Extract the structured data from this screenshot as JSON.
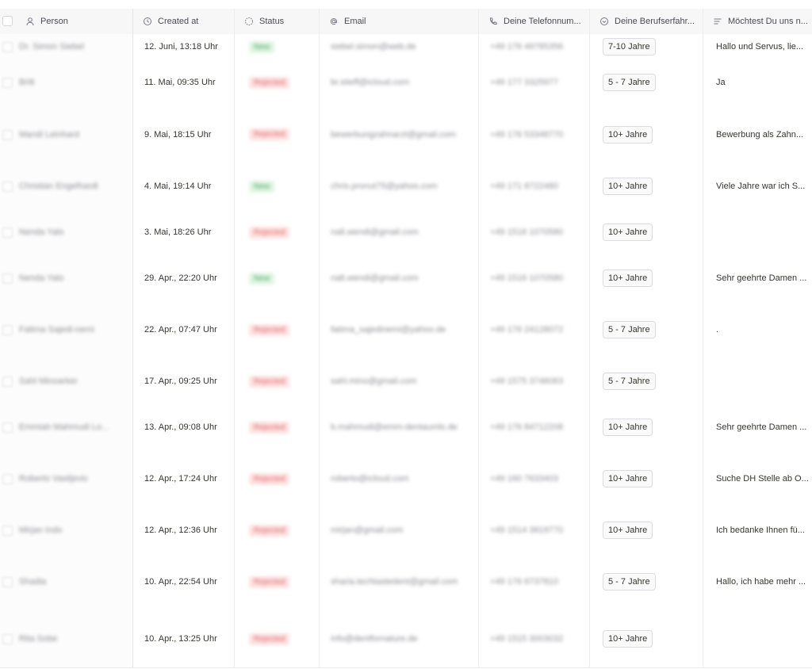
{
  "columns": [
    {
      "label": "Person",
      "icon": "person-icon"
    },
    {
      "label": "Created at",
      "icon": "clock-icon"
    },
    {
      "label": "Status",
      "icon": "status-icon"
    },
    {
      "label": "Email",
      "icon": "at-icon"
    },
    {
      "label": "Deine Telefonnum...",
      "icon": "phone-icon"
    },
    {
      "label": "Deine Berufserfahr...",
      "icon": "circle-select-icon"
    },
    {
      "label": "Möchtest Du uns n...",
      "icon": "text-lines-icon"
    }
  ],
  "rows": [
    {
      "person": "Dr. Simon Siebel",
      "created": "12. Juni, 13:18 Uhr",
      "status": "New",
      "email": "siebel.simon@web.de",
      "phone": "+49 176 49785356",
      "experience": "7-10 Jahre",
      "message": "Hallo und Servus, lie..."
    },
    {
      "person": "Britt",
      "created": "11. Mai, 09:35 Uhr",
      "status": "Rejected",
      "email": "br.stieff@icloud.com",
      "phone": "+49 177 3325977",
      "experience": "5 - 7 Jahre",
      "message": "Ja"
    },
    {
      "person": "Mandi Leinhard",
      "created": "9. Mai, 18:15 Uhr",
      "status": "Rejected",
      "email": "bewerbungzahnarzt@gmail.com",
      "phone": "+49 176 53348770",
      "experience": "10+ Jahre",
      "message": "Bewerbung als Zahn..."
    },
    {
      "person": "Christian Engelhardt",
      "created": "4. Mai, 19:14 Uhr",
      "status": "New",
      "email": "chris.pronut75@yahoo.com",
      "phone": "+49 171 8722480",
      "experience": "10+ Jahre",
      "message": "Viele Jahre war ich S..."
    },
    {
      "person": "Nenda Yalo",
      "created": "3. Mai, 18:26 Uhr",
      "status": "Rejected",
      "email": "nalt.wendi@gmail.com",
      "phone": "+49 1516 1070580",
      "experience": "10+ Jahre",
      "message": ""
    },
    {
      "person": "Nenda Yalo",
      "created": "29. Apr., 22:20 Uhr",
      "status": "New",
      "email": "nalt.wendi@gmail.com",
      "phone": "+49 1516 1070580",
      "experience": "10+ Jahre",
      "message": "Sehr geehrte Damen ..."
    },
    {
      "person": "Fatima Sajedi-nemi",
      "created": "22. Apr., 07:47 Uhr",
      "status": "Rejected",
      "email": "fatima_sajedinemi@yahoo.de",
      "phone": "+49 176 24128072",
      "experience": "5 - 7 Jahre",
      "message": "."
    },
    {
      "person": "Sahl Minoarker",
      "created": "17. Apr., 09:25 Uhr",
      "status": "Rejected",
      "email": "sahl.mino@gmail.com",
      "phone": "+49 1575 3746063",
      "experience": "5 - 7 Jahre",
      "message": ""
    },
    {
      "person": "Emmiah Mahmudi Lo...",
      "created": "13. Apr., 09:08 Uhr",
      "status": "Rejected",
      "email": "b.mahmudi@emm-dentaumls.de",
      "phone": "+49 176 84712208",
      "experience": "10+ Jahre",
      "message": "Sehr geehrte Damen ..."
    },
    {
      "person": "Roberto Vasiljevic",
      "created": "12. Apr., 17:24 Uhr",
      "status": "Rejected",
      "email": "roberto@icloud.com",
      "phone": "+49 160 7633403",
      "experience": "10+ Jahre",
      "message": "Suche DH Stelle ab O..."
    },
    {
      "person": "Mirjan Indo",
      "created": "12. Apr., 12:36 Uhr",
      "status": "Rejected",
      "email": "mirjan@gmail.com",
      "phone": "+49 1514 3819770",
      "experience": "10+ Jahre",
      "message": "Ich bedanke Ihnen fü..."
    },
    {
      "person": "Shadia",
      "created": "10. Apr., 22:54 Uhr",
      "status": "Rejected",
      "email": "sharia.techtastedent@gmail.com",
      "phone": "+49 176 6737810",
      "experience": "5 - 7 Jahre",
      "message": "Hallo, ich habe mehr ..."
    },
    {
      "person": "Rita Sobe",
      "created": "10. Apr., 13:25 Uhr",
      "status": "Rejected",
      "email": "info@dentfornature.de",
      "phone": "+49 1515 3003032",
      "experience": "10+ Jahre",
      "message": ""
    }
  ],
  "status_colors": {
    "New": "#4aa360",
    "Rejected": "#e06565"
  }
}
